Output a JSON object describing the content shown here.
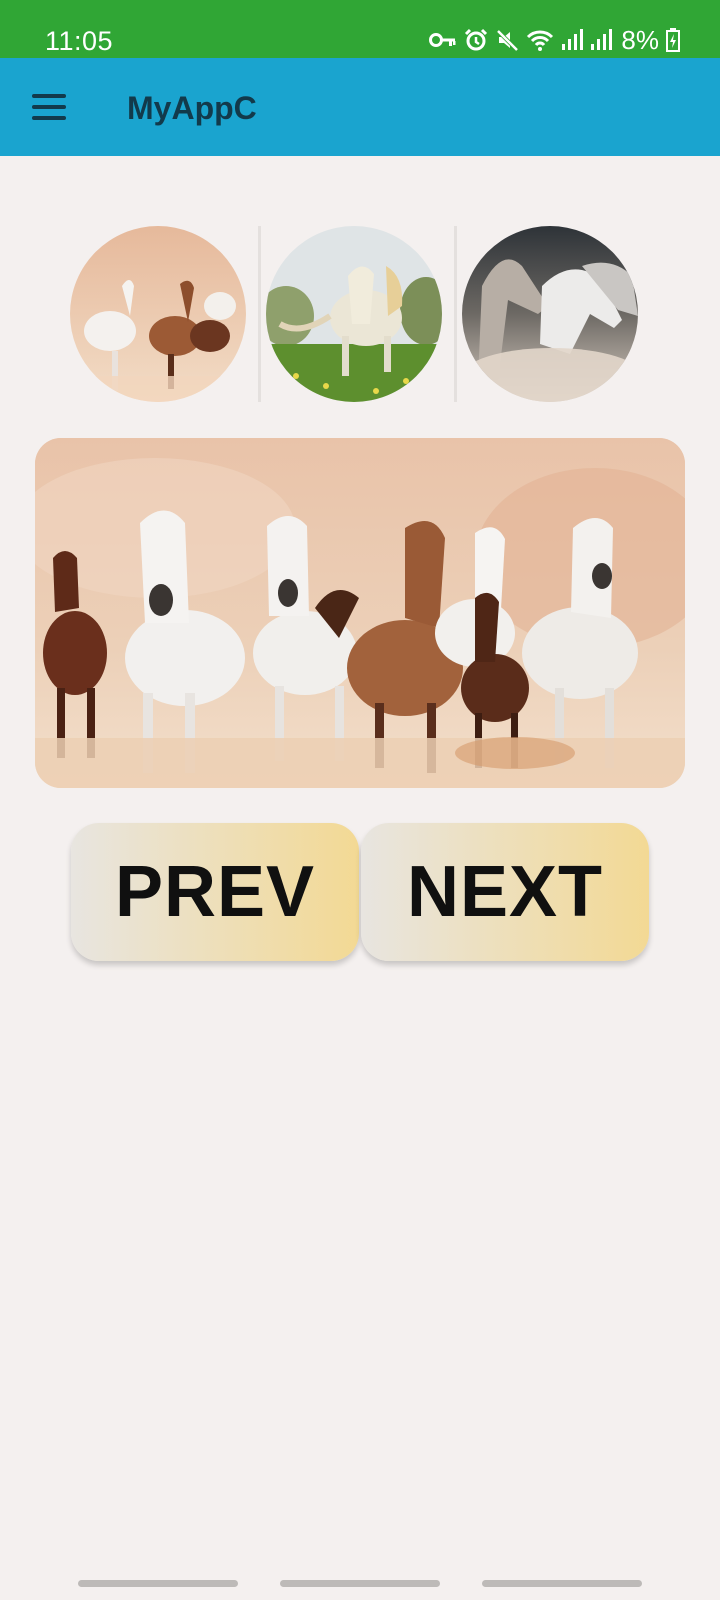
{
  "status_bar": {
    "time": "11:05",
    "battery": "8%",
    "icons": [
      "key-icon",
      "alarm-icon",
      "mute-icon",
      "wifi-icon",
      "signal-icon",
      "signal-icon",
      "battery-charging-icon"
    ],
    "background": "#30a635"
  },
  "app_bar": {
    "title": "MyAppC",
    "menu_icon": "hamburger-menu-icon",
    "background": "#1aa4cf"
  },
  "gallery": {
    "thumbnails": [
      {
        "name": "horses-herd-running-thumbnail"
      },
      {
        "name": "horse-grass-field-thumbnail"
      },
      {
        "name": "grey-horses-dust-thumbnail"
      }
    ],
    "main_image": "horses-herd-running-image"
  },
  "buttons": {
    "prev_label": "PREV",
    "next_label": "NEXT"
  }
}
